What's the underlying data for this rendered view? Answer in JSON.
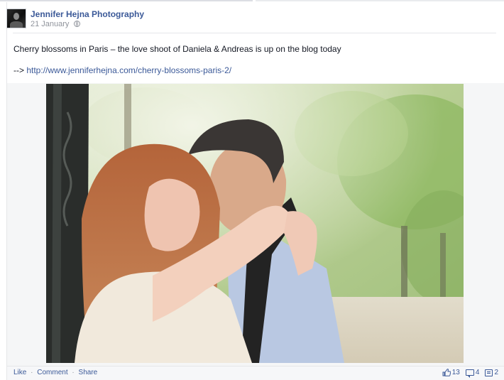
{
  "post": {
    "page_name": "Jennifer Hejna Photography",
    "date": "21 January",
    "message": "Cherry blossoms in Paris – the love shoot of Daniela & Andreas is up on the blog today",
    "link_prefix": "-->",
    "link_url": "http://www.jenniferhejna.com/cherry-blossoms-paris-2/"
  },
  "actions": {
    "like": "Like",
    "comment": "Comment",
    "share": "Share",
    "separator": "·"
  },
  "counts": {
    "likes": "13",
    "comments": "4",
    "shares": "2"
  },
  "icons": {
    "privacy": "globe-icon",
    "likes": "thumbs-up-icon",
    "comments": "comment-icon",
    "shares": "share-icon"
  },
  "colors": {
    "link": "#3b5998",
    "meta_text": "#90949c",
    "body_text": "#141823",
    "action_bar_bg": "#f6f7f9"
  }
}
